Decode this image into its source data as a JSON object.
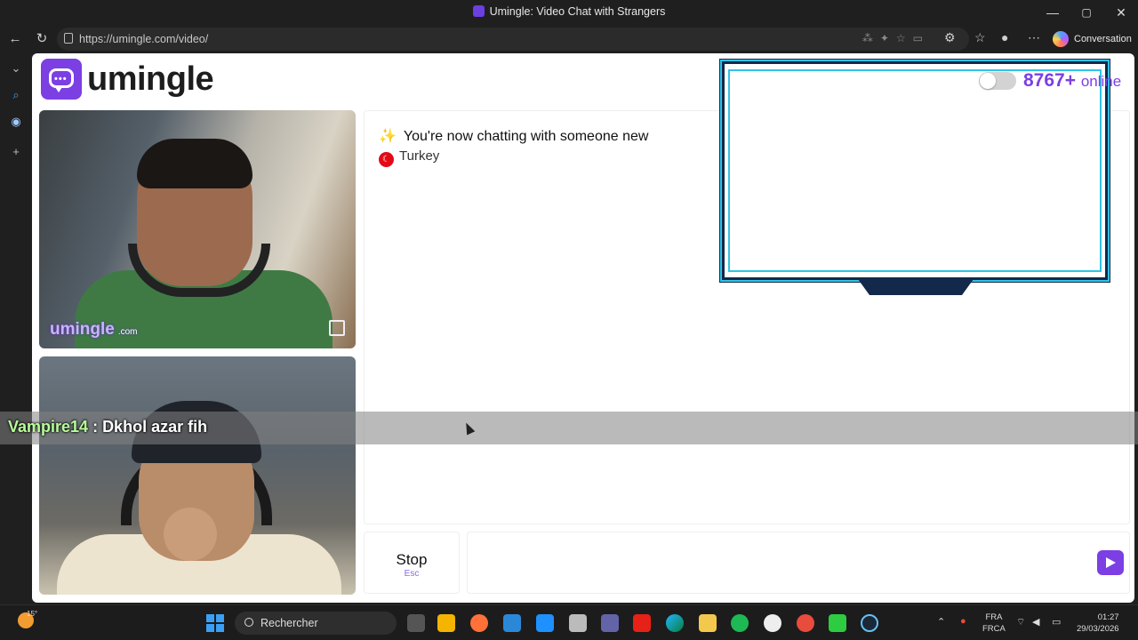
{
  "window": {
    "title": "Umingle: Video Chat with Strangers",
    "controls": {
      "minimize": "—",
      "maximize": "▢",
      "close": "✕"
    }
  },
  "browser": {
    "url": "https://umingle.com/video/",
    "copilot_label": "Conversation"
  },
  "site": {
    "logo_text": "umingle",
    "online_count": "8767+",
    "online_label": "online"
  },
  "videos": {
    "watermark": "umingle",
    "watermark_suffix": ".com"
  },
  "chat": {
    "status_message": "You're now chatting with someone new",
    "country": "Turkey"
  },
  "controls": {
    "stop_label": "Stop",
    "stop_shortcut": "Esc",
    "message_placeholder": ""
  },
  "overlay": {
    "nickname": "Vampire14",
    "separator": " : ",
    "message": "Dkhol azar fih"
  },
  "taskbar": {
    "weather_temp": "15°",
    "search_placeholder": "Rechercher",
    "lang_line1": "FRA",
    "lang_line2": "FRCA",
    "time": "01:27",
    "date": "29/03/2026"
  },
  "colors": {
    "brand_purple": "#7b3fe4",
    "frame_cyan": "#2ec4e6",
    "frame_navy": "#13294b",
    "turkey_red": "#e30a17"
  }
}
